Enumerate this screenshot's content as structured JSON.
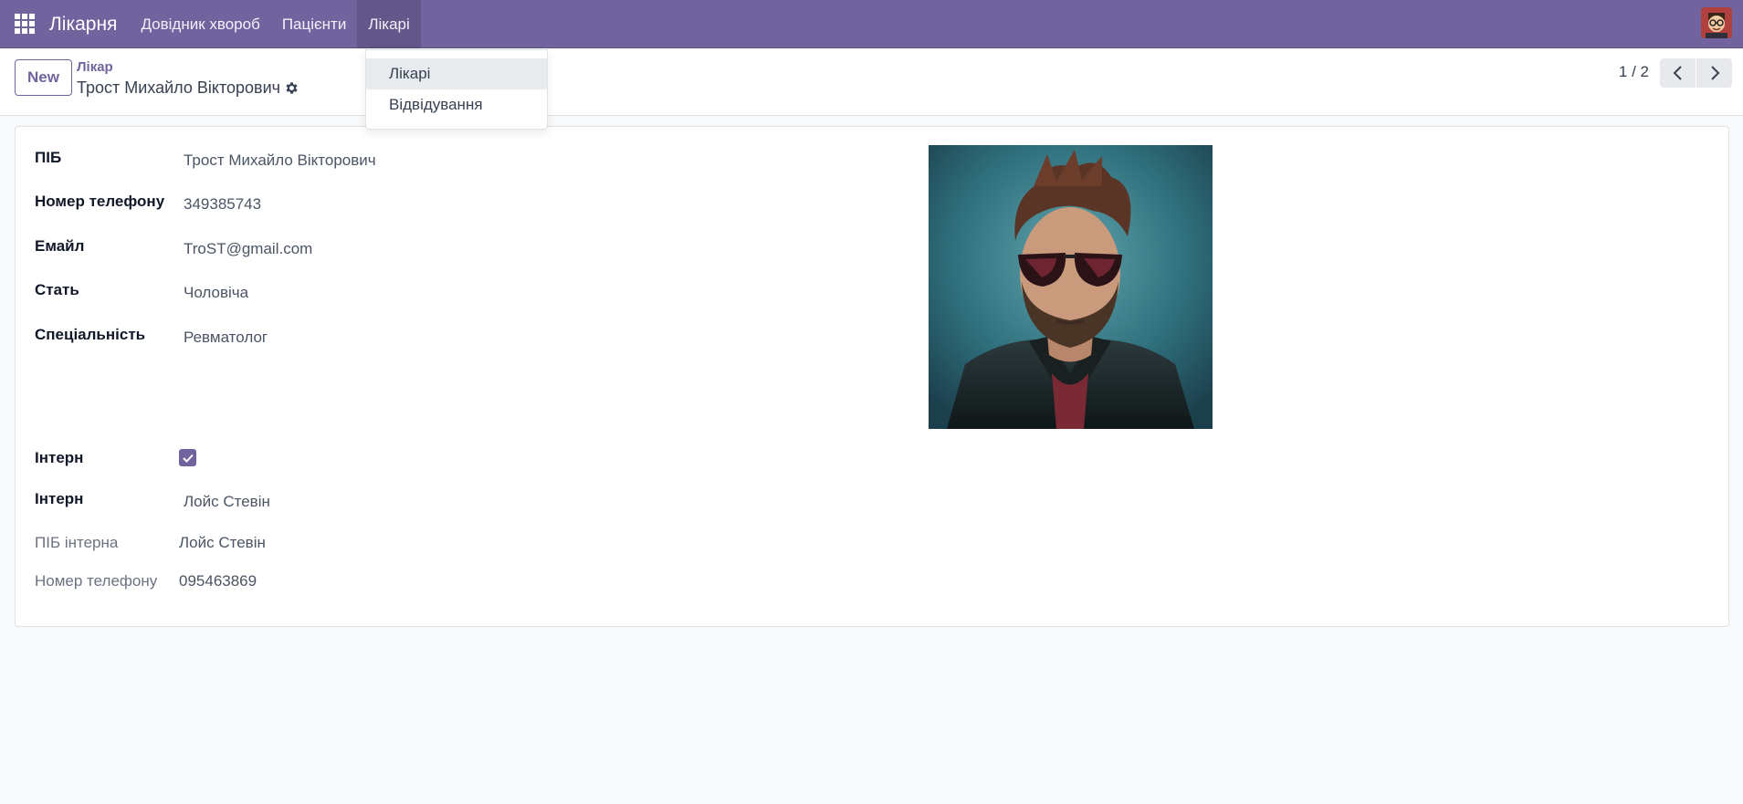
{
  "navbar": {
    "brand": "Лікарня",
    "menu": [
      "Довідник хвороб",
      "Пацієнти",
      "Лікарі"
    ],
    "active_menu": "Лікарі"
  },
  "dropdown": {
    "items": [
      "Лікарі",
      "Відвідування"
    ],
    "hovered_item": "Лікарі"
  },
  "control_panel": {
    "new_label": "New",
    "breadcrumb_parent": "Лікар",
    "breadcrumb_current": "Трост Михайло Вікторович",
    "pager": "1 / 2"
  },
  "form": {
    "fields": [
      {
        "label": "ПІБ",
        "value": "Трост Михайло Вікторович"
      },
      {
        "label": "Номер телефону",
        "value": "349385743"
      },
      {
        "label": "Емайл",
        "value": "TroST@gmail.com"
      },
      {
        "label": "Стать",
        "value": "Чоловіча"
      },
      {
        "label": "Спеціальність",
        "value": "Ревматолог"
      }
    ],
    "intern_flag": {
      "label": "Інтерн",
      "checked": true
    },
    "intern_select": {
      "label": "Інтерн",
      "value": "Лойс Стевін"
    },
    "intern_details": [
      {
        "label": "ПІБ інтерна",
        "value": "Лойс Стевін"
      },
      {
        "label": "Номер телефону",
        "value": "095463869"
      }
    ]
  },
  "colors": {
    "brand": "#71639e",
    "background": "#f8f9fa"
  },
  "icons": {
    "apps": "apps-grid-icon",
    "gear": "gear-icon",
    "prev": "chevron-left-icon",
    "next": "chevron-right-icon",
    "check": "checkmark-icon"
  }
}
